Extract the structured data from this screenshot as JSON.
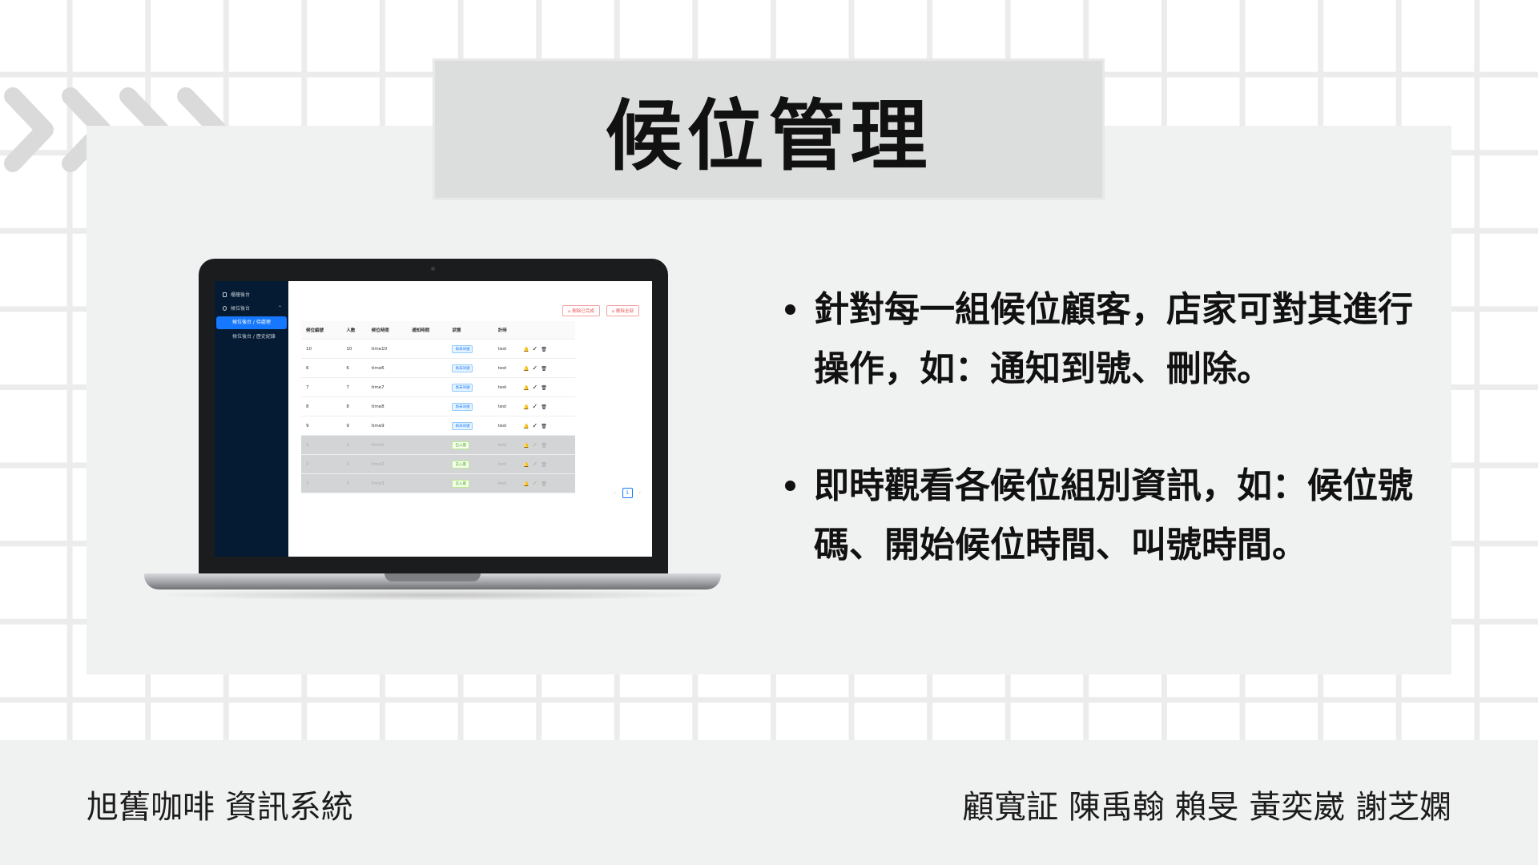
{
  "slide": {
    "title": "候位管理",
    "bullets": [
      "針對每一組候位顧客，店家可對其進行操作，如：通知到號、刪除。",
      "即時觀看各候位組別資訊，如：候位號碼、開始候位時間、叫號時間。"
    ],
    "footer_left": "旭舊咖啡 資訊系統",
    "footer_right": "顧寬証 陳禹翰 賴旻 黃奕崴 謝芝嫻"
  },
  "app": {
    "sidebar": {
      "item1": "櫃檯後台",
      "group": "候位後台",
      "sub_active": "候位後台 / 待處理",
      "sub2": "候位後台 / 歷史紀錄"
    },
    "buttons": {
      "clear_done": "刪除已完成",
      "clear_all": "刪除全部"
    },
    "headers": [
      "候位編號",
      "人數",
      "候位時間",
      "通知時間",
      "狀態",
      "計時",
      ""
    ],
    "rows": [
      {
        "id": "10",
        "people": "10",
        "time": "time10",
        "notify": "",
        "status": "尚未叫號",
        "timer": "test"
      },
      {
        "id": "6",
        "people": "6",
        "time": "time6",
        "notify": "",
        "status": "尚未叫號",
        "timer": "test"
      },
      {
        "id": "7",
        "people": "7",
        "time": "time7",
        "notify": "",
        "status": "尚未叫號",
        "timer": "test"
      },
      {
        "id": "8",
        "people": "8",
        "time": "time8",
        "notify": "",
        "status": "尚未叫號",
        "timer": "test"
      },
      {
        "id": "9",
        "people": "9",
        "time": "time9",
        "notify": "",
        "status": "尚未叫號",
        "timer": "test"
      },
      {
        "id": "1",
        "people": "1",
        "time": "time1",
        "notify": "",
        "status": "已入座",
        "timer": "test"
      },
      {
        "id": "2",
        "people": "2",
        "time": "time2",
        "notify": "",
        "status": "已入座",
        "timer": "test"
      },
      {
        "id": "3",
        "people": "3",
        "time": "time3",
        "notify": "",
        "status": "已入座",
        "timer": "test"
      }
    ],
    "pager": {
      "prev": "‹",
      "page": "1",
      "next": "›"
    },
    "icons": [
      "bell-icon",
      "check-icon",
      "trash-icon"
    ],
    "colors": {
      "sidebar": "#041b33",
      "accent": "#1677ff",
      "danger": "#e55555"
    }
  }
}
